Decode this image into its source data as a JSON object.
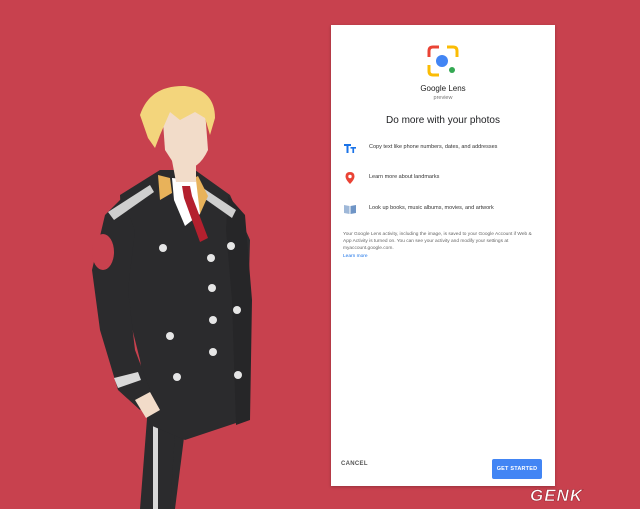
{
  "dialog": {
    "app_name": "Google Lens",
    "app_subtitle": "preview",
    "headline": "Do more with your photos",
    "features": [
      {
        "icon": "text-icon",
        "label": "Copy text like phone numbers, dates, and addresses"
      },
      {
        "icon": "location-pin-icon",
        "label": "Learn more about landmarks"
      },
      {
        "icon": "book-icon",
        "label": "Look up books, music albums, movies, and artwork"
      }
    ],
    "disclaimer": "Your Google Lens activity, including the image, is saved to your Google Account if Web & App Activity is turned on. You can see your activity and modify your settings at myaccount.google.com.",
    "learn_more": "Learn more",
    "cancel_label": "CANCEL",
    "start_label": "GET STARTED"
  },
  "watermark": {
    "logo": "GENK"
  },
  "colors": {
    "background": "#c8414e",
    "accent_blue": "#4285f4",
    "uniform": "#2b2b2d",
    "hair": "#f3d57c"
  }
}
